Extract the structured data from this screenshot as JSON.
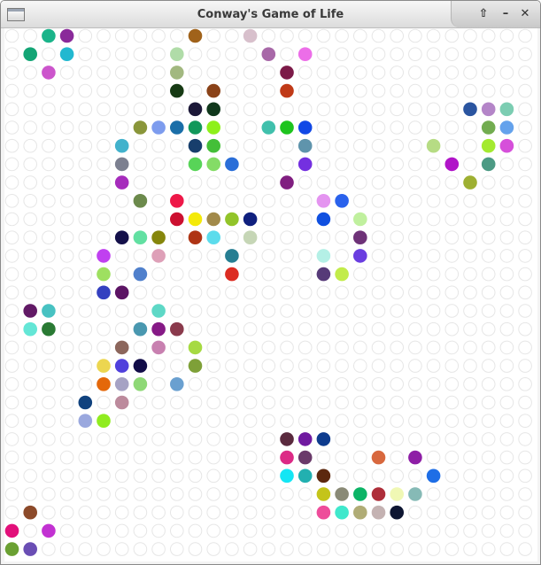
{
  "window": {
    "title": "Conway's Game of Life",
    "controls": {
      "maximize_glyph": "⇧",
      "minimize_glyph": "–",
      "close_glyph": "✕"
    }
  },
  "board": {
    "columns": 29,
    "rows": 29,
    "empty_cell_stroke": "#e6e6e6",
    "live_cells": [
      {
        "col": 2,
        "row": 0,
        "color": "#1ab48a"
      },
      {
        "col": 3,
        "row": 0,
        "color": "#8a2a9a"
      },
      {
        "col": 10,
        "row": 0,
        "color": "#a0621a"
      },
      {
        "col": 13,
        "row": 0,
        "color": "#d8c0cc"
      },
      {
        "col": 1,
        "row": 1,
        "color": "#13a575"
      },
      {
        "col": 3,
        "row": 1,
        "color": "#22b8d0"
      },
      {
        "col": 9,
        "row": 1,
        "color": "#b0dca8"
      },
      {
        "col": 14,
        "row": 1,
        "color": "#a868a8"
      },
      {
        "col": 16,
        "row": 1,
        "color": "#ec6ee8"
      },
      {
        "col": 2,
        "row": 2,
        "color": "#cc55cc"
      },
      {
        "col": 9,
        "row": 2,
        "color": "#a2b880"
      },
      {
        "col": 15,
        "row": 2,
        "color": "#7c1a48"
      },
      {
        "col": 9,
        "row": 3,
        "color": "#173a14"
      },
      {
        "col": 11,
        "row": 3,
        "color": "#8a4218"
      },
      {
        "col": 15,
        "row": 3,
        "color": "#c03a18"
      },
      {
        "col": 10,
        "row": 4,
        "color": "#1c1838"
      },
      {
        "col": 11,
        "row": 4,
        "color": "#10381c"
      },
      {
        "col": 25,
        "row": 4,
        "color": "#2b55a0"
      },
      {
        "col": 26,
        "row": 4,
        "color": "#b485c8"
      },
      {
        "col": 27,
        "row": 4,
        "color": "#7ccdb2"
      },
      {
        "col": 7,
        "row": 5,
        "color": "#8a963a"
      },
      {
        "col": 8,
        "row": 5,
        "color": "#7d9cee"
      },
      {
        "col": 9,
        "row": 5,
        "color": "#1a6ea8"
      },
      {
        "col": 10,
        "row": 5,
        "color": "#12985a"
      },
      {
        "col": 11,
        "row": 5,
        "color": "#8ef01a"
      },
      {
        "col": 14,
        "row": 5,
        "color": "#40c0ac"
      },
      {
        "col": 15,
        "row": 5,
        "color": "#1ec41e"
      },
      {
        "col": 16,
        "row": 5,
        "color": "#1148e6"
      },
      {
        "col": 26,
        "row": 5,
        "color": "#72ac50"
      },
      {
        "col": 27,
        "row": 5,
        "color": "#64a2ec"
      },
      {
        "col": 6,
        "row": 6,
        "color": "#42b2cc"
      },
      {
        "col": 10,
        "row": 6,
        "color": "#173e6c"
      },
      {
        "col": 11,
        "row": 6,
        "color": "#44bf38"
      },
      {
        "col": 16,
        "row": 6,
        "color": "#5f94ac"
      },
      {
        "col": 23,
        "row": 6,
        "color": "#b6dc84"
      },
      {
        "col": 26,
        "row": 6,
        "color": "#a4ea30"
      },
      {
        "col": 27,
        "row": 6,
        "color": "#d650da"
      },
      {
        "col": 6,
        "row": 7,
        "color": "#7c8090"
      },
      {
        "col": 10,
        "row": 7,
        "color": "#58d458"
      },
      {
        "col": 11,
        "row": 7,
        "color": "#84dc66"
      },
      {
        "col": 12,
        "row": 7,
        "color": "#2a6ed8"
      },
      {
        "col": 16,
        "row": 7,
        "color": "#7430e0"
      },
      {
        "col": 24,
        "row": 7,
        "color": "#b014c8"
      },
      {
        "col": 26,
        "row": 7,
        "color": "#4c9a84"
      },
      {
        "col": 6,
        "row": 8,
        "color": "#a62cbc"
      },
      {
        "col": 15,
        "row": 8,
        "color": "#801e80"
      },
      {
        "col": 25,
        "row": 8,
        "color": "#9eb032"
      },
      {
        "col": 7,
        "row": 9,
        "color": "#6c8a4c"
      },
      {
        "col": 9,
        "row": 9,
        "color": "#ee1848"
      },
      {
        "col": 17,
        "row": 9,
        "color": "#e494f0"
      },
      {
        "col": 18,
        "row": 9,
        "color": "#2a62ec"
      },
      {
        "col": 9,
        "row": 10,
        "color": "#cc1030"
      },
      {
        "col": 10,
        "row": 10,
        "color": "#f4ea0a"
      },
      {
        "col": 11,
        "row": 10,
        "color": "#a28a4a"
      },
      {
        "col": 12,
        "row": 10,
        "color": "#92c42a"
      },
      {
        "col": 13,
        "row": 10,
        "color": "#10207e"
      },
      {
        "col": 17,
        "row": 10,
        "color": "#1050e0"
      },
      {
        "col": 19,
        "row": 10,
        "color": "#c0f09e"
      },
      {
        "col": 6,
        "row": 11,
        "color": "#14104a"
      },
      {
        "col": 7,
        "row": 11,
        "color": "#62e0a2"
      },
      {
        "col": 8,
        "row": 11,
        "color": "#86860c"
      },
      {
        "col": 10,
        "row": 11,
        "color": "#ae3414"
      },
      {
        "col": 11,
        "row": 11,
        "color": "#5cdcec"
      },
      {
        "col": 13,
        "row": 11,
        "color": "#c6d6b6"
      },
      {
        "col": 19,
        "row": 11,
        "color": "#6e3278"
      },
      {
        "col": 5,
        "row": 12,
        "color": "#c040f0"
      },
      {
        "col": 8,
        "row": 12,
        "color": "#dea0b8"
      },
      {
        "col": 12,
        "row": 12,
        "color": "#267e92"
      },
      {
        "col": 17,
        "row": 12,
        "color": "#b4f0e6"
      },
      {
        "col": 19,
        "row": 12,
        "color": "#6a3ee0"
      },
      {
        "col": 5,
        "row": 13,
        "color": "#9ee060"
      },
      {
        "col": 7,
        "row": 13,
        "color": "#5080cc"
      },
      {
        "col": 12,
        "row": 13,
        "color": "#dc2c22"
      },
      {
        "col": 17,
        "row": 13,
        "color": "#563a78"
      },
      {
        "col": 18,
        "row": 13,
        "color": "#c2ec4a"
      },
      {
        "col": 5,
        "row": 14,
        "color": "#3440c0"
      },
      {
        "col": 6,
        "row": 14,
        "color": "#5c1464"
      },
      {
        "col": 1,
        "row": 15,
        "color": "#621a66"
      },
      {
        "col": 2,
        "row": 15,
        "color": "#48c2c2"
      },
      {
        "col": 8,
        "row": 15,
        "color": "#5ed8c6"
      },
      {
        "col": 1,
        "row": 16,
        "color": "#64e6d6"
      },
      {
        "col": 2,
        "row": 16,
        "color": "#2a7a34"
      },
      {
        "col": 7,
        "row": 16,
        "color": "#4a98b0"
      },
      {
        "col": 8,
        "row": 16,
        "color": "#861a86"
      },
      {
        "col": 9,
        "row": 16,
        "color": "#8a3a4c"
      },
      {
        "col": 6,
        "row": 17,
        "color": "#8c665c"
      },
      {
        "col": 8,
        "row": 17,
        "color": "#c880b0"
      },
      {
        "col": 10,
        "row": 17,
        "color": "#a6da42"
      },
      {
        "col": 5,
        "row": 18,
        "color": "#ecd650"
      },
      {
        "col": 6,
        "row": 18,
        "color": "#5040dc"
      },
      {
        "col": 7,
        "row": 18,
        "color": "#120c48"
      },
      {
        "col": 10,
        "row": 18,
        "color": "#7ea038"
      },
      {
        "col": 5,
        "row": 19,
        "color": "#e4680a"
      },
      {
        "col": 6,
        "row": 19,
        "color": "#a6a2c4"
      },
      {
        "col": 7,
        "row": 19,
        "color": "#8ed876"
      },
      {
        "col": 9,
        "row": 19,
        "color": "#6aa0d0"
      },
      {
        "col": 4,
        "row": 20,
        "color": "#10427e"
      },
      {
        "col": 6,
        "row": 20,
        "color": "#bc8a9c"
      },
      {
        "col": 4,
        "row": 21,
        "color": "#9aa8de"
      },
      {
        "col": 5,
        "row": 21,
        "color": "#90ec20"
      },
      {
        "col": 15,
        "row": 22,
        "color": "#5a2a3e"
      },
      {
        "col": 16,
        "row": 22,
        "color": "#701aa0"
      },
      {
        "col": 17,
        "row": 22,
        "color": "#0e3c8e"
      },
      {
        "col": 15,
        "row": 23,
        "color": "#dc2a86"
      },
      {
        "col": 16,
        "row": 23,
        "color": "#6a3a6a"
      },
      {
        "col": 20,
        "row": 23,
        "color": "#d8683e"
      },
      {
        "col": 22,
        "row": 23,
        "color": "#8e1ea6"
      },
      {
        "col": 15,
        "row": 24,
        "color": "#14e6f4"
      },
      {
        "col": 16,
        "row": 24,
        "color": "#22b0b0"
      },
      {
        "col": 17,
        "row": 24,
        "color": "#5c280e"
      },
      {
        "col": 23,
        "row": 24,
        "color": "#1e6ee6"
      },
      {
        "col": 17,
        "row": 25,
        "color": "#c4c41a"
      },
      {
        "col": 18,
        "row": 25,
        "color": "#8a8a76"
      },
      {
        "col": 19,
        "row": 25,
        "color": "#0cb466"
      },
      {
        "col": 20,
        "row": 25,
        "color": "#ae2e3a"
      },
      {
        "col": 21,
        "row": 25,
        "color": "#f0f8b4"
      },
      {
        "col": 22,
        "row": 25,
        "color": "#86bab6"
      },
      {
        "col": 1,
        "row": 26,
        "color": "#8c4a2a"
      },
      {
        "col": 17,
        "row": 26,
        "color": "#ee4c9a"
      },
      {
        "col": 18,
        "row": 26,
        "color": "#40e8cc"
      },
      {
        "col": 19,
        "row": 26,
        "color": "#b0ac76"
      },
      {
        "col": 20,
        "row": 26,
        "color": "#c4b2b2"
      },
      {
        "col": 21,
        "row": 26,
        "color": "#0e1632"
      },
      {
        "col": 0,
        "row": 27,
        "color": "#e2107a"
      },
      {
        "col": 2,
        "row": 27,
        "color": "#c232d2"
      },
      {
        "col": 0,
        "row": 28,
        "color": "#6aa032"
      },
      {
        "col": 1,
        "row": 28,
        "color": "#6a4eb4"
      }
    ]
  }
}
